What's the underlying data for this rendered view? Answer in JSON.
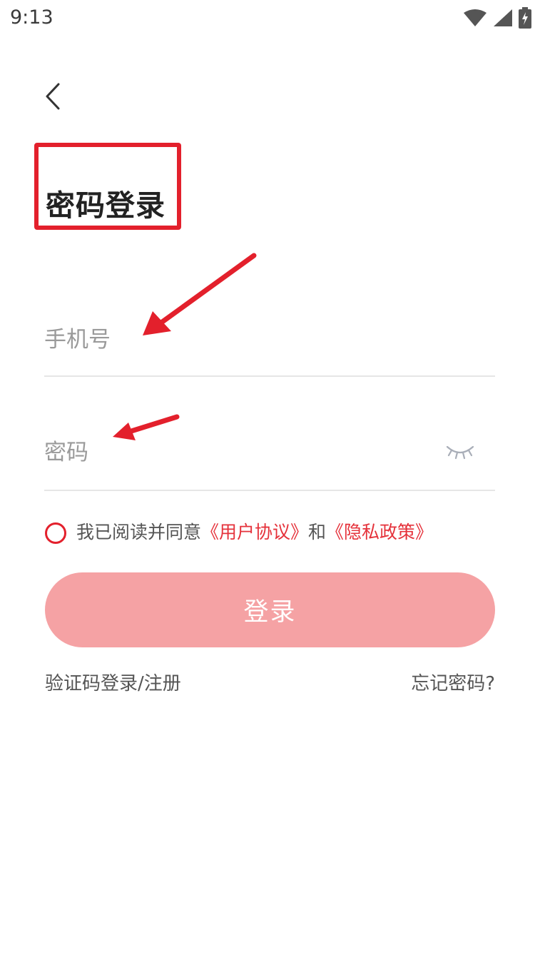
{
  "status_bar": {
    "time": "9:13",
    "icons": [
      "wifi-icon",
      "signal-icon",
      "battery-charging-icon"
    ]
  },
  "header": {
    "back_icon": "chevron-left-icon"
  },
  "title": "密码登录",
  "phone_input": {
    "placeholder": "手机号",
    "value": ""
  },
  "password_input": {
    "placeholder": "密码",
    "value": "",
    "toggle_icon": "eye-closed-icon"
  },
  "agreement": {
    "prefix": "我已阅读并同意",
    "user_agreement": "《用户协议》",
    "conjunction": "和",
    "privacy_policy": "《隐私政策》",
    "checked": false
  },
  "login_button": {
    "label": "登录"
  },
  "links": {
    "sms_login": "验证码登录/注册",
    "forgot_password": "忘记密码?"
  },
  "colors": {
    "accent": "#e5323b",
    "login_button_bg": "#f5a2a4",
    "annotation_red": "#e3202c"
  }
}
